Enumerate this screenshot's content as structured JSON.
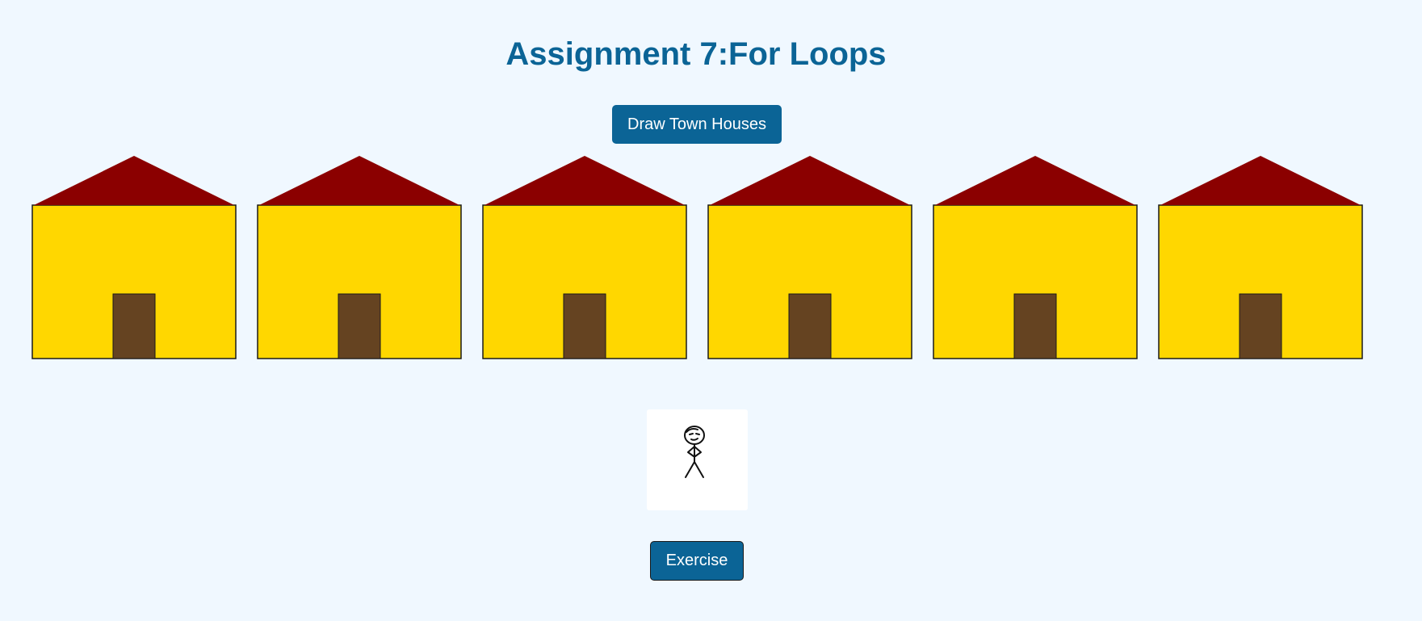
{
  "page": {
    "title": "Assignment 7:For Loops"
  },
  "buttons": {
    "draw_label": "Draw Town Houses",
    "exercise_label": "Exercise"
  },
  "town": {
    "house_count": 6,
    "colors": {
      "wall": "#ffd700",
      "roof": "#8b0000",
      "door": "#654321",
      "outline": "#1a1a1a"
    }
  },
  "figure": {
    "icon": "stick-figure-icon"
  },
  "colors": {
    "background": "#f0f8ff",
    "accent": "#0b6496",
    "button_text": "#ffffff"
  }
}
